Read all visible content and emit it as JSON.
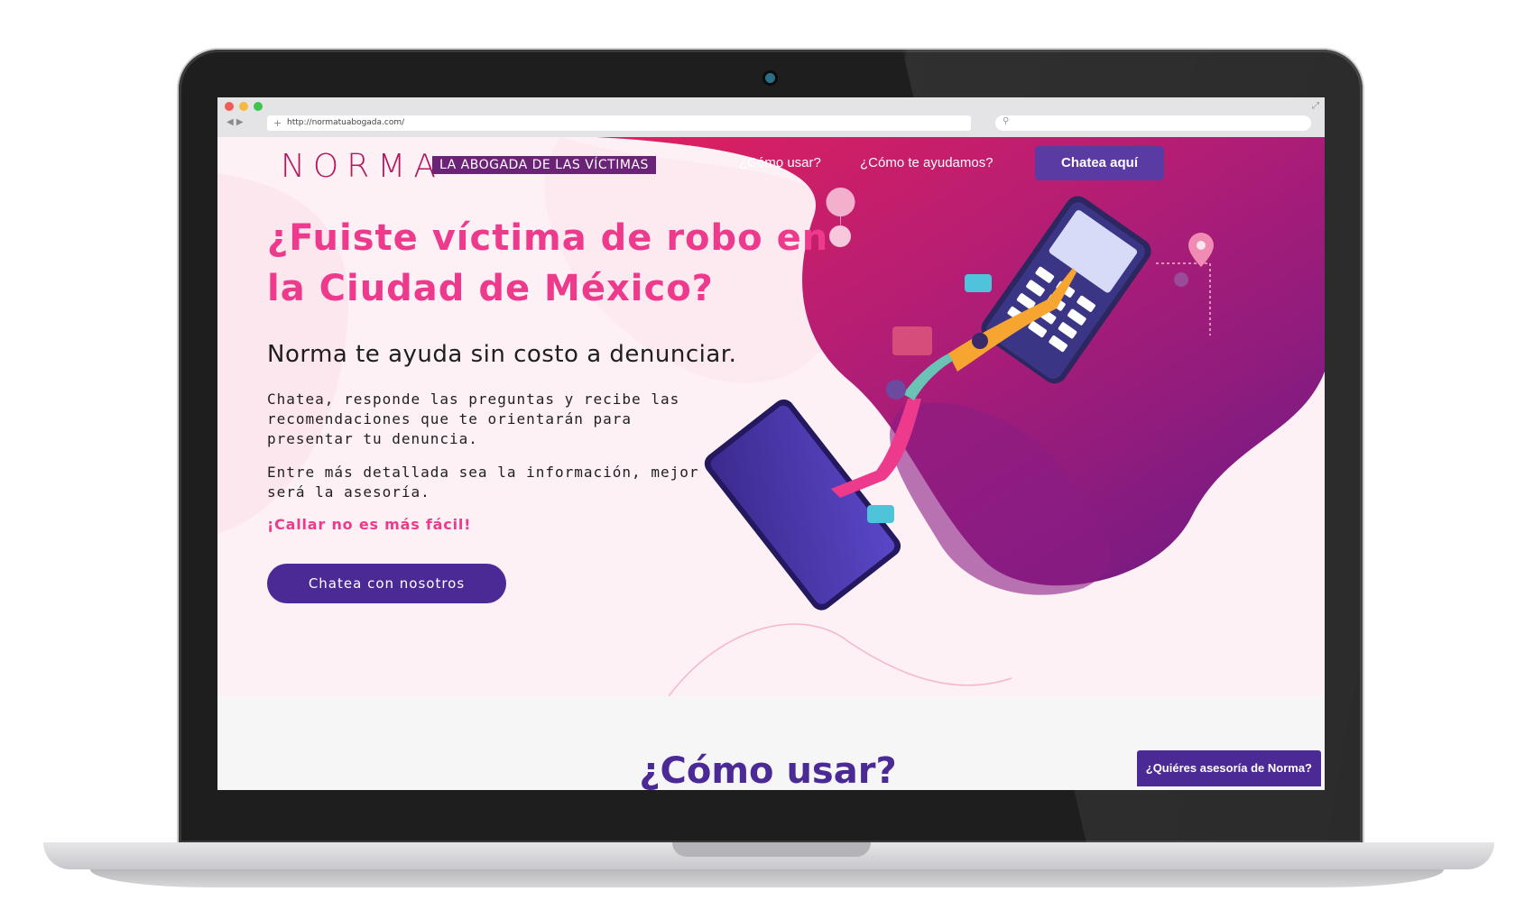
{
  "browser": {
    "url": "http://normatuabogada.com/"
  },
  "logo": {
    "word": "NORMA",
    "tagline": "LA ABOGADA DE LAS VÍCTIMAS"
  },
  "nav": {
    "links": [
      "¿Cómo usar?",
      "¿Cómo te ayudamos?"
    ],
    "cta": "Chatea aquí"
  },
  "hero": {
    "headline_line1": "¿Fuiste víctima de robo en",
    "headline_line2": "la Ciudad de México?",
    "subhead": "Norma te ayuda sin costo a denunciar.",
    "paragraph1": "Chatea, responde las preguntas y recibe las recomendaciones que te orientarán para presentar tu denuncia.",
    "paragraph2": "Entre más detallada sea la información, mejor será la asesoría.",
    "callout": "¡Callar no es más fácil!",
    "button": "Chatea con nosotros"
  },
  "section2": {
    "title": "¿Cómo usar?"
  },
  "floating_tab": "¿Quiéres asesoría de Norma?",
  "colors": {
    "brand_pink": "#ee3a8c",
    "brand_purple": "#4b2a95",
    "magenta": "#c0185f"
  }
}
